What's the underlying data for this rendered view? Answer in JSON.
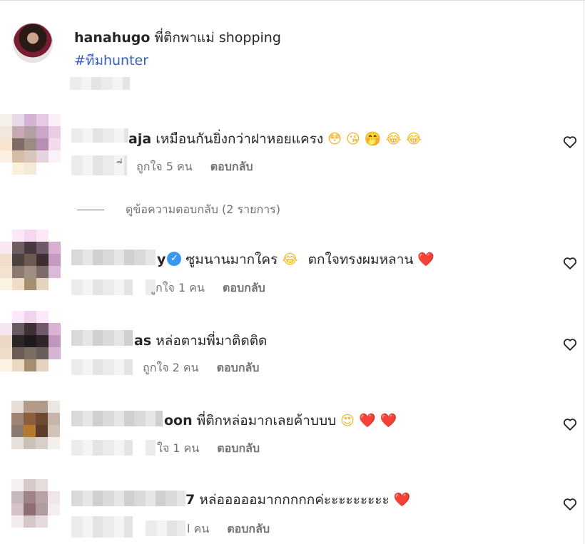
{
  "caption": {
    "username": "hanahugo",
    "text": "พี่ติกพาแม่ shopping",
    "hashtag": "#ทีมhunter"
  },
  "comments": [
    {
      "username_visible": "aja",
      "text": "เหมือนกันยิ่งกว่าฝาหอยแครง",
      "emojis": [
        "😳",
        "😘",
        "🤭",
        "😂",
        "😂"
      ],
      "meta_prefix": "ี่",
      "likes": "ถูกใจ 5 คน",
      "reply_label": "ตอบกลับ",
      "view_replies": "ดูข้อความตอบกลับ (2 รายการ)"
    },
    {
      "username_visible": "y",
      "verified": "✓",
      "text": "ซูมนานมากใคร",
      "emoji_mid": "😂",
      "text2": "ตกใจทรงผมหลาน",
      "emojis": [
        "❤️"
      ],
      "likes": "ูกใจ 1 คน",
      "reply_label": "ตอบกลับ"
    },
    {
      "username_visible": "as",
      "text": "หล่อตามพี่มาติดติด",
      "emojis": [],
      "likes": "ถูกใจ 2 คน",
      "reply_label": "ตอบกลับ"
    },
    {
      "username_visible": "oon",
      "text": "พี่ติกหล่อมากเลยค้าบบบ",
      "emojis": [
        "😍",
        "❤️",
        "❤️"
      ],
      "likes": "ใจ 1 คน",
      "reply_label": "ตอบกลับ"
    },
    {
      "username_visible": "7",
      "text": "หล่อออออมากกกกกค่ะะะะะะะะะ",
      "emojis": [
        "❤️"
      ],
      "likes": "l คน",
      "reply_label": "ตอบกลับ"
    }
  ],
  "icons": {
    "like": "heart-outline-icon"
  },
  "colors": {
    "hashtag": "#3a5ec4",
    "muted": "#737373",
    "verified": "#3897f0",
    "heart": "#e0245e"
  }
}
